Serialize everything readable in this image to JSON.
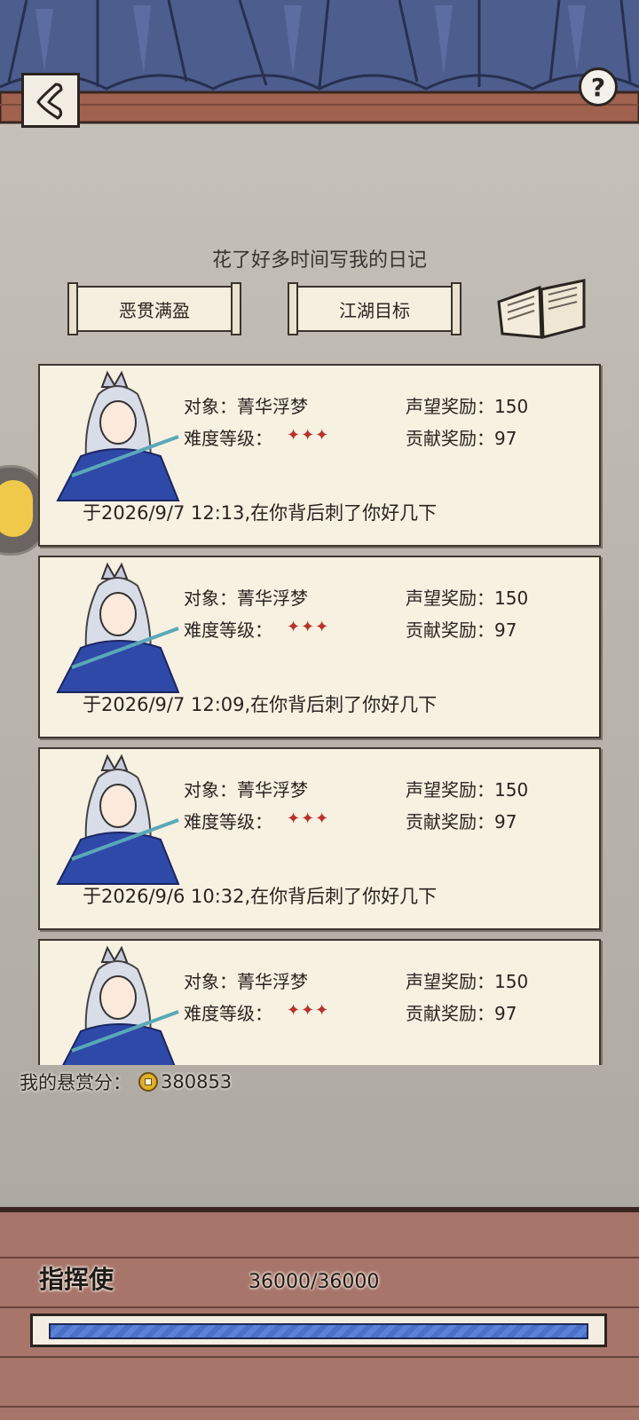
{
  "header": {
    "subtitle": "花了好多时间写我的日记",
    "back_icon": "back-arrow-icon",
    "help_label": "?"
  },
  "tabs": [
    {
      "label": "恶贯满盈"
    },
    {
      "label": "江湖目标"
    }
  ],
  "records": [
    {
      "target_label": "对象：",
      "target": "菁华浮梦",
      "difficulty_label": "难度等级：",
      "difficulty_stars": 3,
      "stars": "✦✦✦",
      "fame_label": "声望奖励：",
      "fame": "150",
      "contrib_label": "贡献奖励：",
      "contrib": "97",
      "record": "于2026/9/7 12:13,在你背后刺了你好几下"
    },
    {
      "target_label": "对象：",
      "target": "菁华浮梦",
      "difficulty_label": "难度等级：",
      "difficulty_stars": 3,
      "stars": "✦✦✦",
      "fame_label": "声望奖励：",
      "fame": "150",
      "contrib_label": "贡献奖励：",
      "contrib": "97",
      "record": "于2026/9/7 12:09,在你背后刺了你好几下"
    },
    {
      "target_label": "对象：",
      "target": "菁华浮梦",
      "difficulty_label": "难度等级：",
      "difficulty_stars": 3,
      "stars": "✦✦✦",
      "fame_label": "声望奖励：",
      "fame": "150",
      "contrib_label": "贡献奖励：",
      "contrib": "97",
      "record": "于2026/9/6 10:32,在你背后刺了你好几下"
    },
    {
      "target_label": "对象：",
      "target": "菁华浮梦",
      "difficulty_label": "难度等级：",
      "difficulty_stars": 3,
      "stars": "✦✦✦",
      "fame_label": "声望奖励：",
      "fame": "150",
      "contrib_label": "贡献奖励：",
      "contrib": "97",
      "record": ""
    }
  ],
  "bounty": {
    "label": "我的悬赏分：",
    "value": "380853",
    "icon": "coin-icon"
  },
  "rank": {
    "title": "指挥使",
    "progress_text": "36000/36000",
    "progress_fraction": 1.0
  },
  "colors": {
    "roof": "#4a5a8a",
    "beam": "#a0624e",
    "star": "#b8322c",
    "bar": "#4a70c8",
    "brick": "#a8756a"
  }
}
